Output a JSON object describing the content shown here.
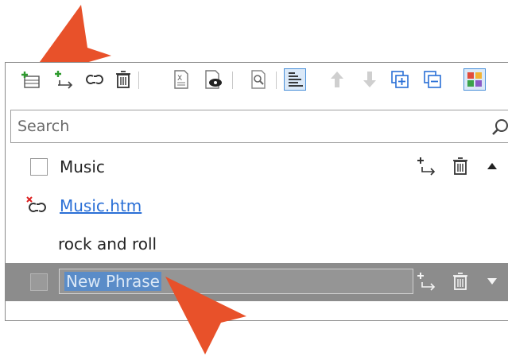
{
  "toolbar": {
    "icons": [
      "add-item-icon",
      "add-child-icon",
      "link-icon",
      "delete-icon",
      "excel-export-icon",
      "preview-icon",
      "find-icon",
      "sort-icon",
      "move-up-icon",
      "move-down-icon",
      "expand-all-icon",
      "collapse-all-icon",
      "color-grid-icon"
    ]
  },
  "search": {
    "placeholder": "Search"
  },
  "rows": [
    {
      "label": "Music"
    },
    {
      "label": "Music.htm"
    },
    {
      "label": "rock and roll"
    },
    {
      "label": "New Phrase"
    }
  ],
  "colors": {
    "selected_row": "#8c8c8c",
    "highlight": "#5a8cc8",
    "callout": "#e8512a",
    "link": "#2a6fd6"
  }
}
